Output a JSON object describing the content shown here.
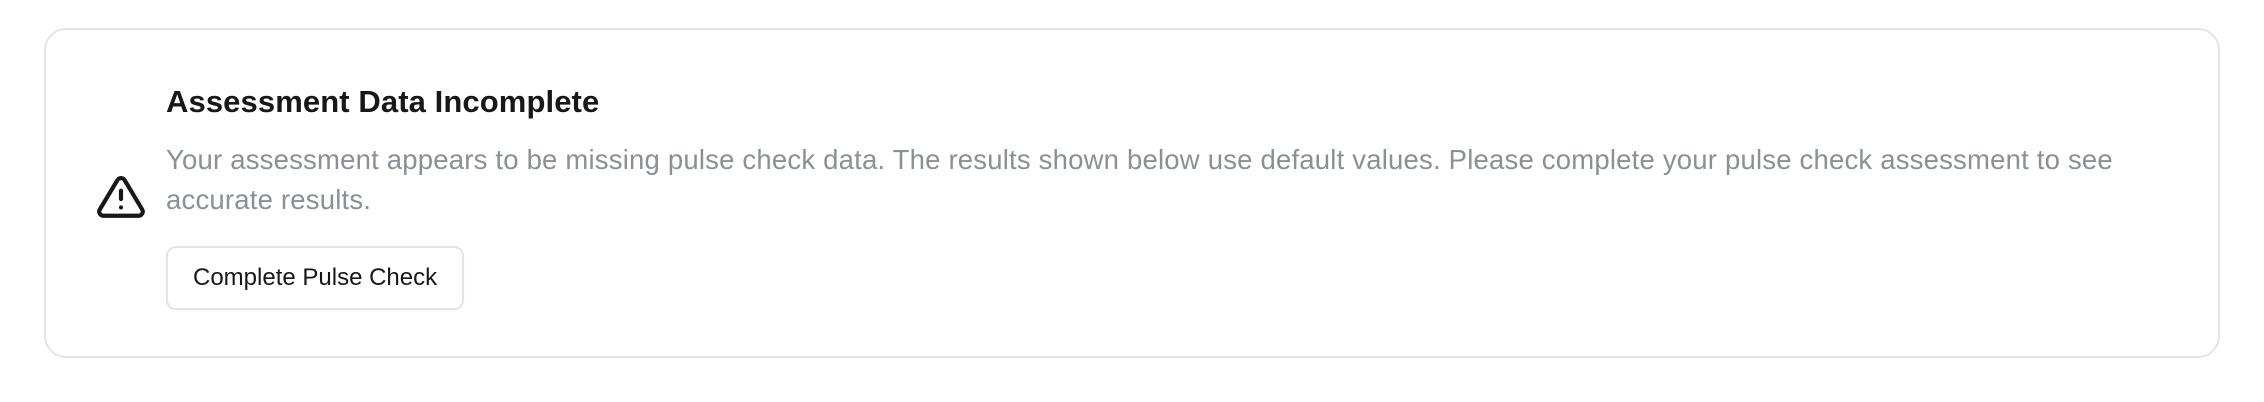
{
  "alert": {
    "icon": "alert-triangle-icon",
    "title": "Assessment Data Incomplete",
    "description": "Your assessment appears to be missing pulse check data. The results shown below use default values. Please complete your pulse check assessment to see accurate results.",
    "action_label": "Complete Pulse Check"
  },
  "colors": {
    "border": "#e4e4e7",
    "title": "#18181b",
    "description": "#8a8f98",
    "icon": "#18181b"
  }
}
